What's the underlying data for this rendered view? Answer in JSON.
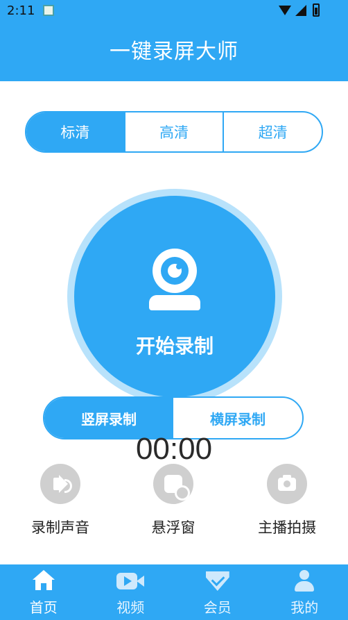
{
  "status_bar": {
    "time": "2:11"
  },
  "app_bar": {
    "title": "一键录屏大师"
  },
  "quality_tabs": [
    {
      "label": "标清",
      "selected": true
    },
    {
      "label": "高清",
      "selected": false
    },
    {
      "label": "超清",
      "selected": false
    }
  ],
  "record_button": {
    "label": "开始录制",
    "icon": "webcam-icon"
  },
  "orientation": [
    {
      "label": "竖屏录制",
      "selected": true
    },
    {
      "label": "横屏录制",
      "selected": false
    }
  ],
  "timer": "00:00",
  "tools": [
    {
      "label": "录制声音",
      "icon": "speaker-icon"
    },
    {
      "label": "悬浮窗",
      "icon": "floating-window-icon"
    },
    {
      "label": "主播拍摄",
      "icon": "camera-icon"
    }
  ],
  "tab_bar": [
    {
      "label": "首页",
      "icon": "home-icon",
      "active": true
    },
    {
      "label": "视频",
      "icon": "video-icon",
      "active": false
    },
    {
      "label": "会员",
      "icon": "vip-icon",
      "active": false
    },
    {
      "label": "我的",
      "icon": "person-icon",
      "active": false
    }
  ],
  "colors": {
    "primary": "#2FA8F4",
    "ring": "#B8E2FB",
    "tool_bg": "#cfcfcf"
  }
}
